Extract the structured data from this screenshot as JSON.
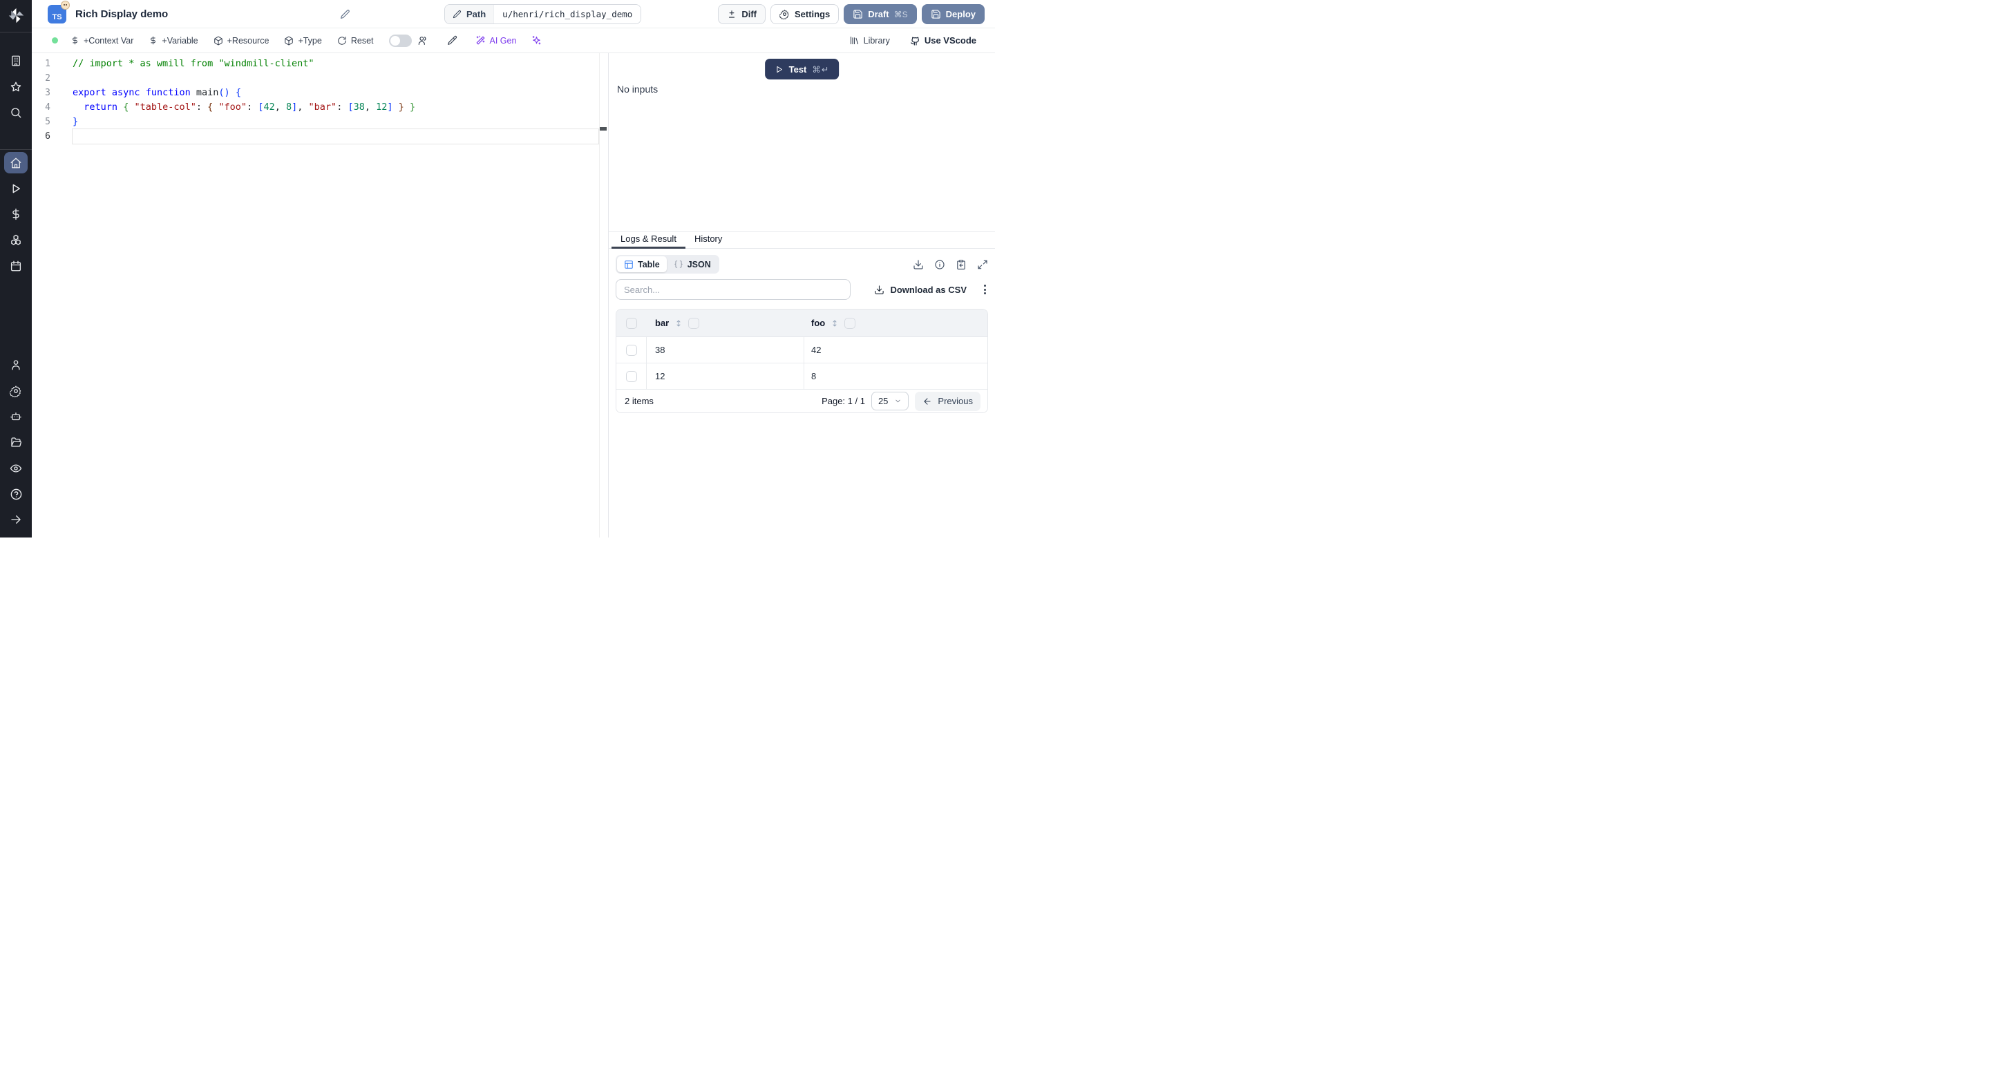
{
  "colors": {
    "sidebar_bg": "#1c1f27",
    "sidebar_active": "#4e5f85",
    "primary_button": "#6b80a4",
    "test_button": "#2e3b5e",
    "ai_purple": "#7c3aed",
    "status_green": "#74e09a",
    "table_icon_blue": "#3b82f6",
    "ts_badge_blue": "#3f7be0"
  },
  "header": {
    "title": "Rich Display demo",
    "lang_badge": "TS",
    "path_label": "Path",
    "path_value": "u/henri/rich_display_demo",
    "diff_label": "Diff",
    "settings_label": "Settings",
    "draft_label": "Draft",
    "draft_kbd": "⌘S",
    "deploy_label": "Deploy"
  },
  "toolbar": {
    "context_var": "+Context Var",
    "variable": "+Variable",
    "resource": "+Resource",
    "type": "+Type",
    "reset": "Reset",
    "ai_gen": "AI Gen",
    "library": "Library",
    "use_vscode": "Use VScode"
  },
  "editor": {
    "lines": [
      {
        "num": 1,
        "tokens": [
          {
            "t": "// import * as wmill from \"windmill-client\"",
            "c": "comment"
          }
        ]
      },
      {
        "num": 2,
        "tokens": []
      },
      {
        "num": 3,
        "tokens": [
          {
            "t": "export",
            "c": "kw"
          },
          {
            "t": " ",
            "c": "pl"
          },
          {
            "t": "async",
            "c": "kw"
          },
          {
            "t": " ",
            "c": "pl"
          },
          {
            "t": "function",
            "c": "kw"
          },
          {
            "t": " ",
            "c": "pl"
          },
          {
            "t": "main",
            "c": "fn"
          },
          {
            "t": "(",
            "c": "b1"
          },
          {
            "t": ")",
            "c": "b1"
          },
          {
            "t": " ",
            "c": "pl"
          },
          {
            "t": "{",
            "c": "b1"
          }
        ]
      },
      {
        "num": 4,
        "tokens": [
          {
            "t": "  ",
            "c": "pl"
          },
          {
            "t": "return",
            "c": "kw"
          },
          {
            "t": " ",
            "c": "pl"
          },
          {
            "t": "{",
            "c": "b2"
          },
          {
            "t": " ",
            "c": "pl"
          },
          {
            "t": "\"table-col\"",
            "c": "str"
          },
          {
            "t": ": ",
            "c": "pl"
          },
          {
            "t": "{",
            "c": "b3"
          },
          {
            "t": " ",
            "c": "pl"
          },
          {
            "t": "\"foo\"",
            "c": "str"
          },
          {
            "t": ": ",
            "c": "pl"
          },
          {
            "t": "[",
            "c": "b1"
          },
          {
            "t": "42",
            "c": "num"
          },
          {
            "t": ", ",
            "c": "pl"
          },
          {
            "t": "8",
            "c": "num"
          },
          {
            "t": "]",
            "c": "b1"
          },
          {
            "t": ", ",
            "c": "pl"
          },
          {
            "t": "\"bar\"",
            "c": "str"
          },
          {
            "t": ": ",
            "c": "pl"
          },
          {
            "t": "[",
            "c": "b1"
          },
          {
            "t": "38",
            "c": "num"
          },
          {
            "t": ", ",
            "c": "pl"
          },
          {
            "t": "12",
            "c": "num"
          },
          {
            "t": "]",
            "c": "b1"
          },
          {
            "t": " ",
            "c": "pl"
          },
          {
            "t": "}",
            "c": "b3"
          },
          {
            "t": " ",
            "c": "pl"
          },
          {
            "t": "}",
            "c": "b2"
          }
        ]
      },
      {
        "num": 5,
        "tokens": [
          {
            "t": "}",
            "c": "b1"
          }
        ]
      },
      {
        "num": 6,
        "tokens": [],
        "current": true
      }
    ]
  },
  "runner": {
    "test_label": "Test",
    "test_kbd": "⌘↵",
    "no_inputs": "No inputs"
  },
  "result": {
    "tabs": [
      "Logs & Result",
      "History"
    ],
    "view_table": "Table",
    "view_json": "JSON",
    "search_placeholder": "Search...",
    "download_csv": "Download as CSV",
    "table": {
      "columns": [
        "bar",
        "foo"
      ],
      "rows": [
        [
          "38",
          "42"
        ],
        [
          "12",
          "8"
        ]
      ],
      "items_label": "2 items",
      "page_label": "Page: 1 / 1",
      "page_size": "25",
      "previous_label": "Previous"
    }
  }
}
